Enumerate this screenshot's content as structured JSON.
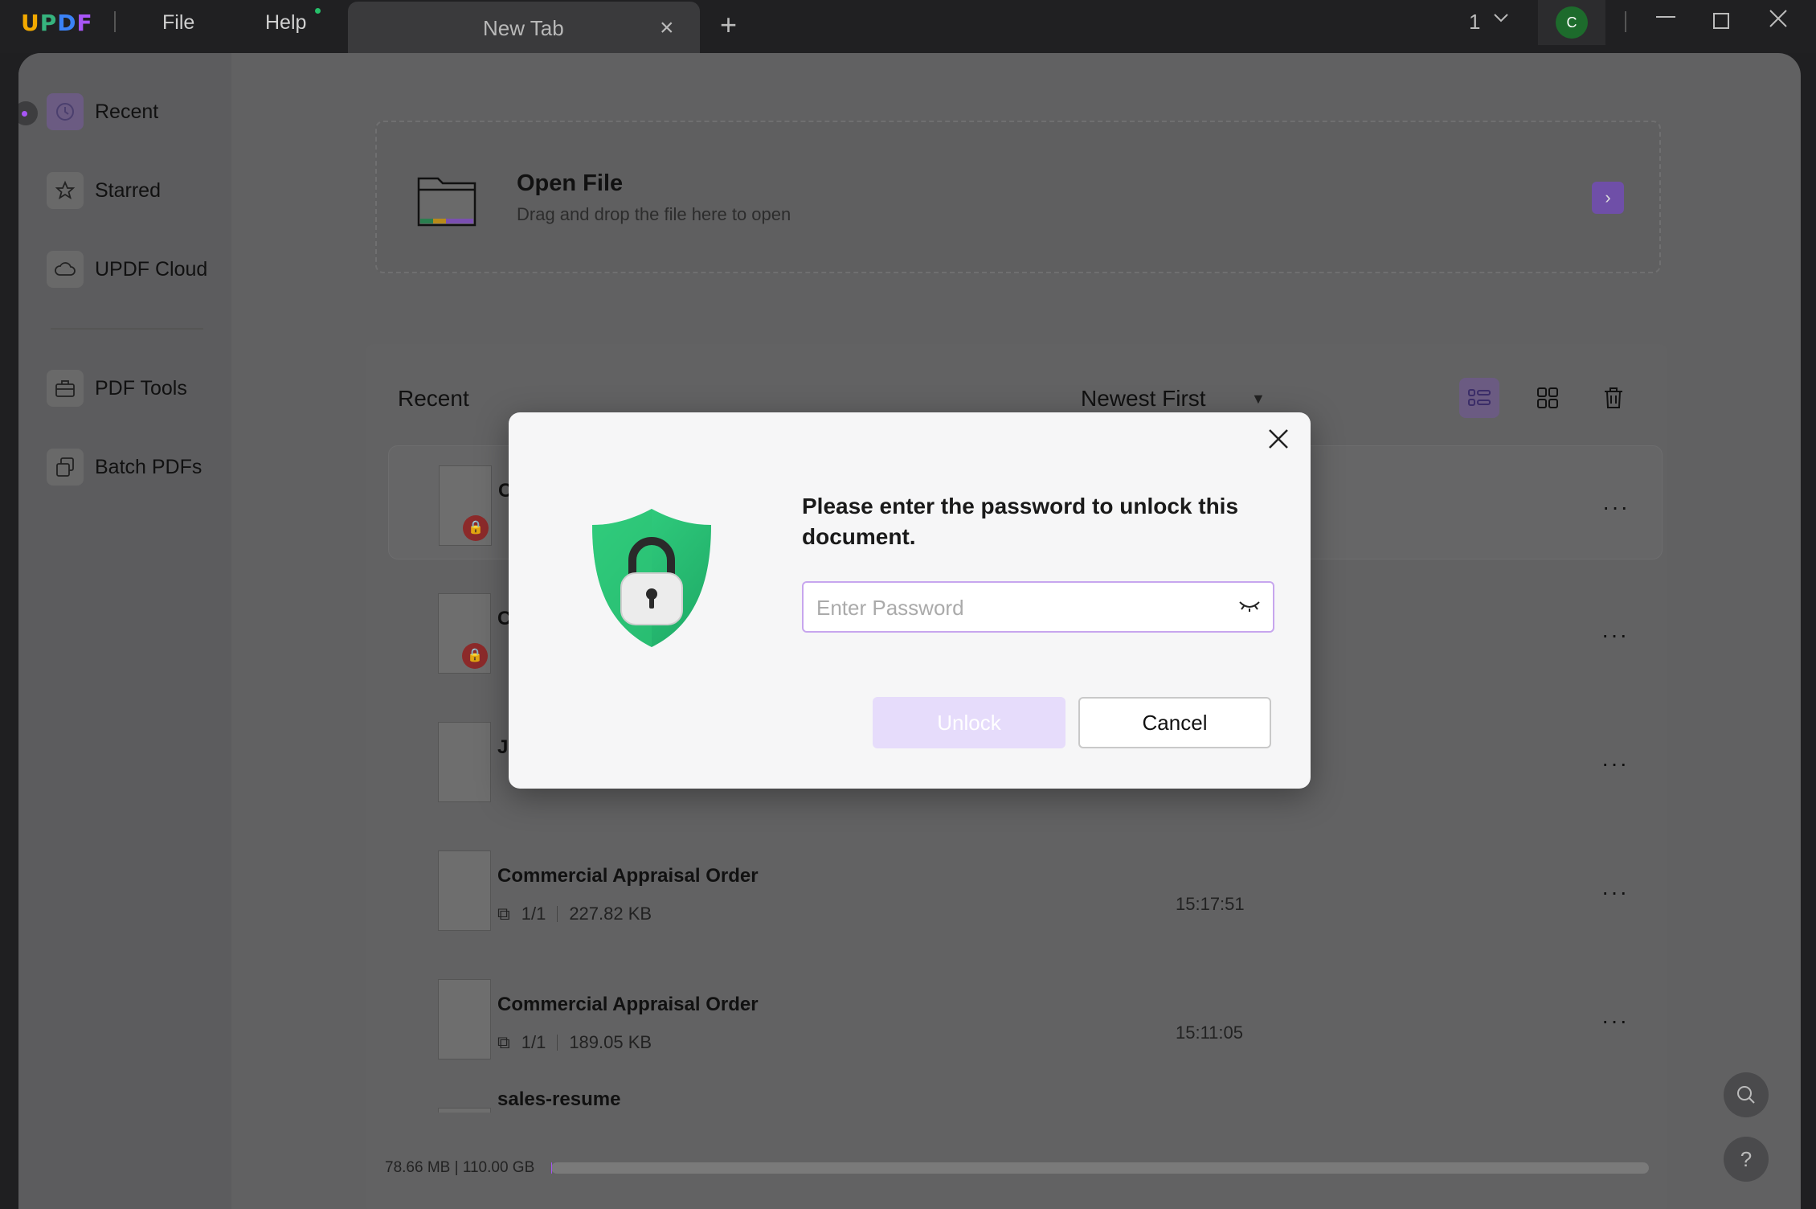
{
  "titlebar": {
    "logo": "UPDF",
    "menu_file": "File",
    "menu_help": "Help",
    "tab_label": "New Tab",
    "tab_close": "×",
    "new_tab": "+",
    "page_count": "1",
    "avatar_initial": "C"
  },
  "sidebar": {
    "items": [
      {
        "label": "Recent",
        "icon": "clock-icon"
      },
      {
        "label": "Starred",
        "icon": "star-icon"
      },
      {
        "label": "UPDF Cloud",
        "icon": "cloud-icon"
      },
      {
        "label": "PDF Tools",
        "icon": "toolbox-icon"
      },
      {
        "label": "Batch PDFs",
        "icon": "batch-icon"
      }
    ]
  },
  "open_file": {
    "title": "Open File",
    "subtitle": "Drag and drop the file here to open"
  },
  "recent": {
    "title": "Recent",
    "sort": "Newest First",
    "files": [
      {
        "name": "C",
        "locked": true
      },
      {
        "name": "C",
        "locked": true
      },
      {
        "name": "J",
        "locked": false
      },
      {
        "name": "Commercial Appraisal Order",
        "pages": "1/1",
        "size": "227.82 KB",
        "time": "15:17:51"
      },
      {
        "name": "Commercial Appraisal Order",
        "pages": "1/1",
        "size": "189.05 KB",
        "time": "15:11:05"
      },
      {
        "name": "sales-resume"
      }
    ]
  },
  "storage": {
    "label": "78.66 MB | 110.00 GB",
    "fraction": 0.0007
  },
  "dialog": {
    "title": "Please enter the password to unlock this document.",
    "placeholder": "Enter Password",
    "unlock": "Unlock",
    "cancel": "Cancel"
  },
  "colors": {
    "accent": "#a855f7",
    "shield": "#2fc578",
    "unlock_disabled": "#e6dcfb"
  }
}
